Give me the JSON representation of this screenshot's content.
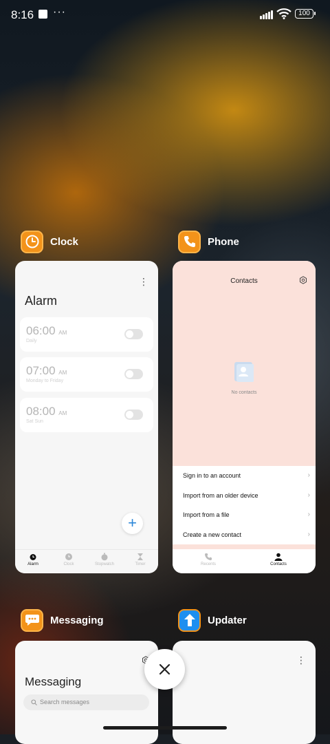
{
  "status_bar": {
    "time": "8:16",
    "dots": "···",
    "battery": "100"
  },
  "apps": {
    "clock": {
      "name": "Clock",
      "title": "Alarm",
      "alarms": [
        {
          "time": "06:00",
          "ampm": "AM",
          "repeat": "Daily"
        },
        {
          "time": "07:00",
          "ampm": "AM",
          "repeat": "Monday to Friday"
        },
        {
          "time": "08:00",
          "ampm": "AM",
          "repeat": "Sat Sun"
        }
      ],
      "fab": "+",
      "tabs": [
        "Alarm",
        "Clock",
        "Stopwatch",
        "Timer"
      ]
    },
    "phone": {
      "name": "Phone",
      "title": "Contacts",
      "empty_text": "No contacts",
      "menu": [
        "Sign in to an account",
        "Import from an older device",
        "Import from a file",
        "Create a new contact"
      ],
      "tabs": [
        "Recents",
        "Contacts"
      ]
    },
    "messaging": {
      "name": "Messaging",
      "title": "Messaging",
      "search_placeholder": "Search messages"
    },
    "updater": {
      "name": "Updater"
    }
  },
  "colors": {
    "accent_orange": "#f3931a",
    "accent_blue": "#1e8ff0",
    "phone_pink": "#fbe1da"
  }
}
